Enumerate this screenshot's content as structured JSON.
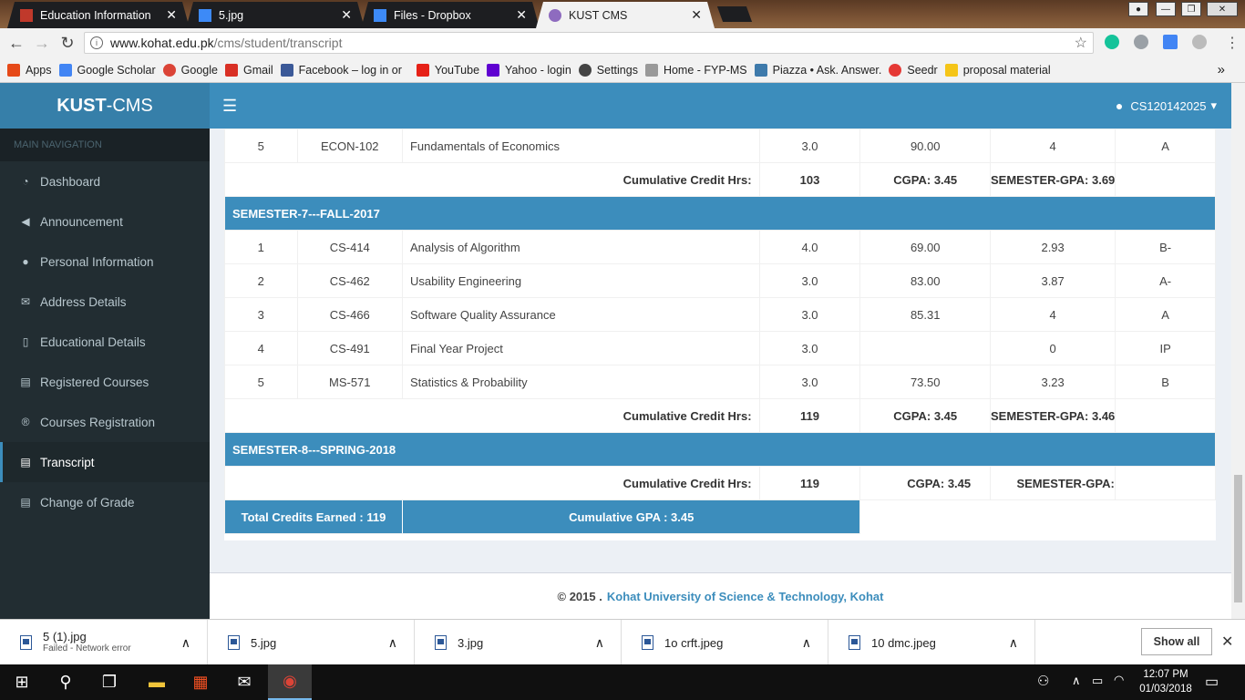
{
  "browser": {
    "tabs": [
      {
        "title": "Education Information",
        "icon": "pdf-icon",
        "color": "#c0392b"
      },
      {
        "title": "5.jpg",
        "icon": "dropbox-icon",
        "color": "#3d8af7"
      },
      {
        "title": "Files - Dropbox",
        "icon": "dropbox-icon",
        "color": "#3d8af7"
      },
      {
        "title": "KUST CMS",
        "icon": "kust-icon",
        "color": "#8e6bbf"
      }
    ],
    "close_glyph": "✕",
    "url_host": "www.kohat.edu.pk",
    "url_path": "/cms/student/transcript",
    "bookmarks": [
      {
        "label": "Apps",
        "icon": "apps-grid-icon",
        "color": "#e64a19"
      },
      {
        "label": "Google Scholar",
        "icon": "scholar-icon",
        "color": "#4285f4"
      },
      {
        "label": "Google",
        "icon": "google-icon",
        "color": "#db4437"
      },
      {
        "label": "Gmail",
        "icon": "gmail-icon",
        "color": "#d93025"
      },
      {
        "label": "Facebook – log in or",
        "icon": "facebook-icon",
        "color": "#3b5998"
      },
      {
        "label": "YouTube",
        "icon": "youtube-icon",
        "color": "#e62117"
      },
      {
        "label": "Yahoo - login",
        "icon": "yahoo-icon",
        "color": "#5f01d1"
      },
      {
        "label": "Settings",
        "icon": "gear-icon",
        "color": "#444444"
      },
      {
        "label": "Home - FYP-MS",
        "icon": "page-icon",
        "color": "#999999"
      },
      {
        "label": "Piazza • Ask. Answer.",
        "icon": "piazza-icon",
        "color": "#3e7aab"
      },
      {
        "label": "Seedr",
        "icon": "seedr-icon",
        "color": "#e53935"
      },
      {
        "label": "proposal material",
        "icon": "folder-icon",
        "color": "#f5c518"
      }
    ],
    "more_glyph": "»"
  },
  "app": {
    "logo_bold": "KUST",
    "logo_rest": "-CMS",
    "nav_header": "MAIN NAVIGATION",
    "nav_items": [
      {
        "label": "Dashboard",
        "icon": "dashboard-icon",
        "glyph": "◔"
      },
      {
        "label": "Announcement",
        "icon": "bullhorn-icon",
        "glyph": "◀"
      },
      {
        "label": "Personal Information",
        "icon": "user-icon",
        "glyph": "●"
      },
      {
        "label": "Address Details",
        "icon": "envelope-icon",
        "glyph": "✉"
      },
      {
        "label": "Educational Details",
        "icon": "box-icon",
        "glyph": "▯"
      },
      {
        "label": "Registered Courses",
        "icon": "book-icon",
        "glyph": "▤"
      },
      {
        "label": "Courses Registration",
        "icon": "registered-icon",
        "glyph": "®"
      },
      {
        "label": "Transcript",
        "icon": "file-icon",
        "glyph": "▤",
        "active": true
      },
      {
        "label": "Change of Grade",
        "icon": "book-icon",
        "glyph": "▤"
      }
    ],
    "hamburger": "☰",
    "user": "CS120142025",
    "user_caret": "▾"
  },
  "transcript": {
    "prev_semester_last_row": {
      "sno": "5",
      "code": "ECON-102",
      "title": "Fundamentals of Economics",
      "credit": "3.0",
      "marks": "90.00",
      "gp": "4",
      "grade": "A"
    },
    "prev_semester_summary": {
      "label": "Cumulative Credit Hrs:",
      "credits": "103",
      "cgpa": "CGPA: 3.45",
      "sgpa": "SEMESTER-GPA: 3.69"
    },
    "semester7": {
      "title": "SEMESTER-7---FALL-2017",
      "rows": [
        {
          "sno": "1",
          "code": "CS-414",
          "title": "Analysis of Algorithm",
          "credit": "4.0",
          "marks": "69.00",
          "gp": "2.93",
          "grade": "B-"
        },
        {
          "sno": "2",
          "code": "CS-462",
          "title": "Usability Engineering",
          "credit": "3.0",
          "marks": "83.00",
          "gp": "3.87",
          "grade": "A-"
        },
        {
          "sno": "3",
          "code": "CS-466",
          "title": "Software Quality Assurance",
          "credit": "3.0",
          "marks": "85.31",
          "gp": "4",
          "grade": "A"
        },
        {
          "sno": "4",
          "code": "CS-491",
          "title": "Final Year Project",
          "credit": "3.0",
          "marks": "",
          "gp": "0",
          "grade": "IP"
        },
        {
          "sno": "5",
          "code": "MS-571",
          "title": "Statistics & Probability",
          "credit": "3.0",
          "marks": "73.50",
          "gp": "3.23",
          "grade": "B"
        }
      ],
      "summary": {
        "label": "Cumulative Credit Hrs:",
        "credits": "119",
        "cgpa": "CGPA: 3.45",
        "sgpa": "SEMESTER-GPA: 3.46"
      }
    },
    "semester8": {
      "title": "SEMESTER-8---SPRING-2018",
      "summary": {
        "label": "Cumulative Credit Hrs:",
        "credits": "119",
        "cgpa": "CGPA: 3.45",
        "sgpa": "SEMESTER-GPA:"
      }
    },
    "totals": {
      "credits_earned": "Total Credits Earned : 119",
      "cgpa": "Cumulative GPA : 3.45"
    }
  },
  "footer": {
    "copyright": "© 2015 .",
    "org": "Kohat University of Science & Technology, Kohat"
  },
  "downloads": {
    "items": [
      {
        "name": "5 (1).jpg",
        "status": "Failed - Network error"
      },
      {
        "name": "5.jpg",
        "status": ""
      },
      {
        "name": "3.jpg",
        "status": ""
      },
      {
        "name": "1o crft.jpeg",
        "status": ""
      },
      {
        "name": "10 dmc.jpeg",
        "status": ""
      }
    ],
    "show_all": "Show all",
    "chevron": "∧",
    "close": "✕"
  },
  "taskbar": {
    "time": "12:07 PM",
    "date": "01/03/2018"
  }
}
